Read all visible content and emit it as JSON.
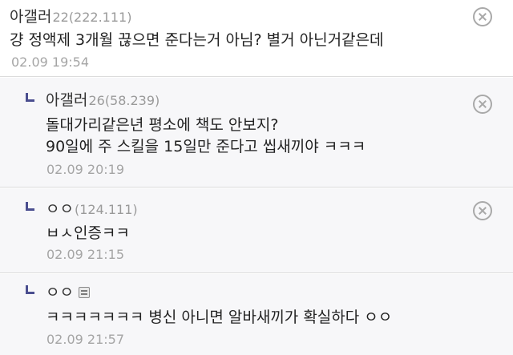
{
  "comments": [
    {
      "nickname": "아갤러",
      "ip": "22(222.111)",
      "lines": [
        "걍 정액제 3개월 끊으면 준다는거 아님? 별거 아닌거같은데"
      ],
      "time": "02.09 19:54"
    },
    {
      "nickname": "아갤러",
      "ip": "26(58.239)",
      "lines": [
        "돌대가리같은년 평소에 책도 안보지?",
        "90일에 주 스킬을 15일만 준다고 씹새끼야 ㅋㅋㅋ"
      ],
      "time": "02.09 20:19"
    },
    {
      "nickname": "ㅇㅇ",
      "ip": "(124.111)",
      "lines": [
        "ㅂㅅ인증ㅋㅋ"
      ],
      "time": "02.09 21:15"
    },
    {
      "nickname": "ㅇㅇ",
      "ip": "",
      "lines": [
        "ㅋㅋㅋㅋㅋㅋㅋ 병신 아니면 알바새끼가 확실하다 ㅇㅇ"
      ],
      "time": "02.09 21:57"
    }
  ],
  "icons": {
    "delete": "close-circle-icon",
    "reply": "reply-arrow-icon",
    "image": "image-icon"
  },
  "colors": {
    "reply_marker": "#4a4e8f",
    "reply_background": "#f7f7f9",
    "ip_text": "#9a9a9a",
    "timestamp": "#a5a5a5"
  }
}
